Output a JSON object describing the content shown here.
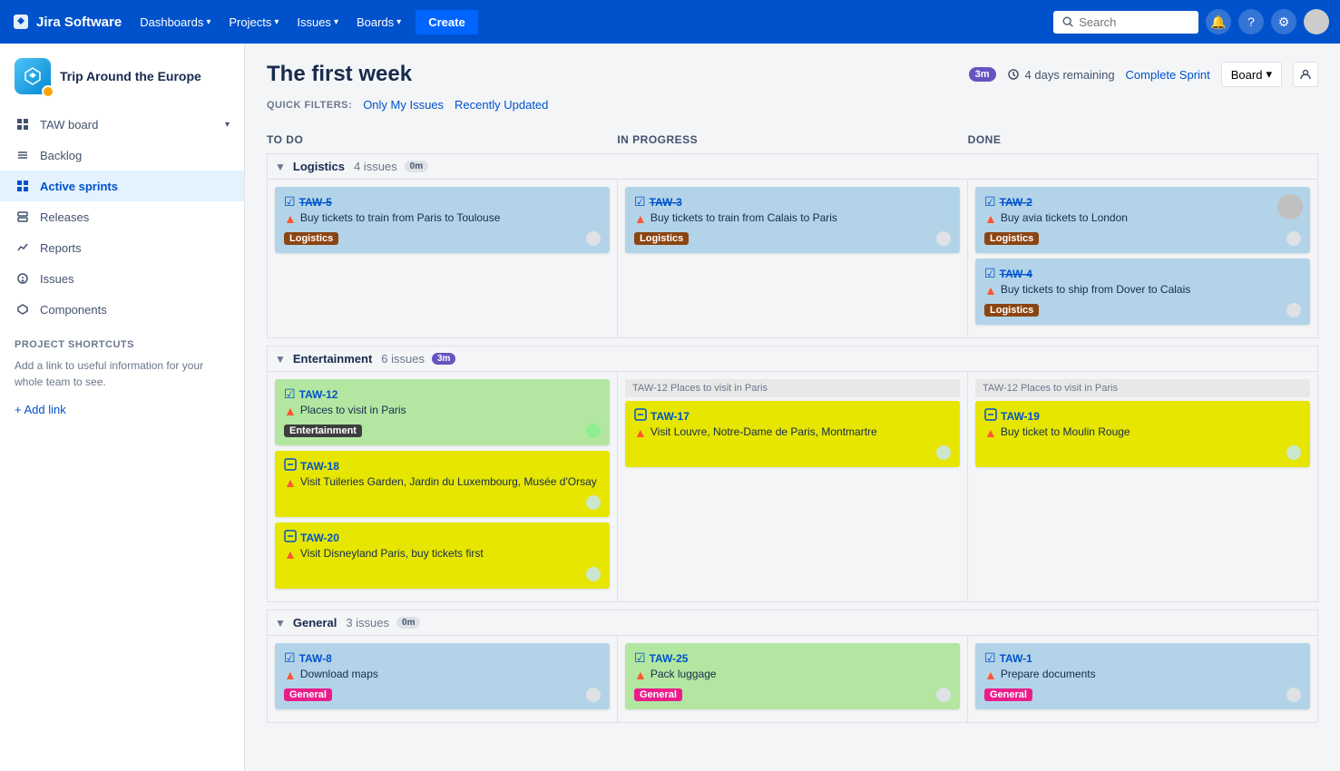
{
  "topnav": {
    "logo_text": "Jira Software",
    "nav_items": [
      {
        "label": "Dashboards",
        "caret": true
      },
      {
        "label": "Projects",
        "caret": true
      },
      {
        "label": "Issues",
        "caret": true
      },
      {
        "label": "Boards",
        "caret": true
      }
    ],
    "create_label": "Create",
    "search_placeholder": "Search"
  },
  "sidebar": {
    "project_name": "Trip Around the Europe",
    "nav_items": [
      {
        "label": "TAW board",
        "icon": "grid",
        "has_caret": true
      },
      {
        "label": "Backlog",
        "icon": "list"
      },
      {
        "label": "Active sprints",
        "icon": "grid",
        "active": true
      },
      {
        "label": "Releases",
        "icon": "layers"
      },
      {
        "label": "Reports",
        "icon": "chart"
      },
      {
        "label": "Issues",
        "icon": "issue"
      },
      {
        "label": "Components",
        "icon": "components"
      }
    ],
    "shortcuts_title": "PROJECT SHORTCUTS",
    "shortcuts_text": "Add a link to useful information for your whole team to see.",
    "add_link_label": "+ Add link"
  },
  "board": {
    "title": "The first week",
    "sprint_badge": "3m",
    "days_remaining": "4 days remaining",
    "complete_sprint_label": "Complete Sprint",
    "board_dropdown_label": "Board",
    "quick_filters_label": "QUICK FILTERS:",
    "filters": [
      "Only My Issues",
      "Recently Updated"
    ],
    "columns": [
      "To Do",
      "In Progress",
      "Done"
    ],
    "swimlanes": [
      {
        "name": "Logistics",
        "count": "4 issues",
        "time_badge": "0m",
        "time_badge_zero": true,
        "columns": [
          {
            "cards": [
              {
                "id": "TAW-5",
                "title": "Buy tickets to train from Paris to Toulouse",
                "label": "Logistics",
                "label_class": "label-logistics",
                "color": "card-blue",
                "icon": "checkbox",
                "strikethrough": true,
                "priority": "up"
              }
            ]
          },
          {
            "cards": [
              {
                "id": "TAW-3",
                "title": "Buy tickets to train from Calais to Paris",
                "label": "Logistics",
                "label_class": "label-logistics",
                "color": "card-blue",
                "icon": "checkbox",
                "strikethrough": true,
                "priority": "up"
              }
            ]
          },
          {
            "cards": [
              {
                "id": "TAW-2",
                "title": "Buy avia tickets to London",
                "label": "Logistics",
                "label_class": "label-logistics",
                "color": "card-blue",
                "icon": "checkbox",
                "strikethrough": true,
                "priority": "up",
                "has_avatar": true
              },
              {
                "id": "TAW-4",
                "title": "Buy tickets to ship from Dover to Calais",
                "label": "Logistics",
                "label_class": "label-logistics",
                "color": "card-blue",
                "icon": "checkbox",
                "strikethrough": true,
                "priority": "up"
              }
            ]
          }
        ]
      },
      {
        "name": "Entertainment",
        "count": "6 issues",
        "time_badge": "3m",
        "time_badge_zero": false,
        "columns": [
          {
            "cards": [
              {
                "id": "TAW-12",
                "title": "Places to visit in Paris",
                "label": "Entertainment",
                "label_class": "label-entertainment",
                "color": "card-green",
                "icon": "checkbox",
                "strikethrough": false,
                "priority": "up"
              },
              {
                "id": "TAW-18",
                "title": "Visit Tuileries Garden, Jardin du Luxembourg, Musée d'Orsay",
                "label": null,
                "color": "card-yellow",
                "icon": "task",
                "strikethrough": false,
                "priority": "up"
              },
              {
                "id": "TAW-20",
                "title": "Visit Disneyland Paris, buy tickets first",
                "label": null,
                "color": "card-yellow",
                "icon": "task",
                "strikethrough": false,
                "priority": "up"
              }
            ]
          },
          {
            "parent_header": "TAW-12  Places to visit in Paris",
            "cards": [
              {
                "id": "TAW-17",
                "title": "Visit Louvre, Notre-Dame de Paris, Montmartre",
                "label": null,
                "color": "card-yellow",
                "icon": "task",
                "strikethrough": false,
                "priority": "up"
              }
            ]
          },
          {
            "parent_header": "TAW-12  Places to visit in Paris",
            "cards": [
              {
                "id": "TAW-19",
                "title": "Buy ticket to Moulin Rouge",
                "label": null,
                "color": "card-yellow",
                "icon": "task",
                "strikethrough": false,
                "priority": "up"
              }
            ]
          }
        ]
      },
      {
        "name": "General",
        "count": "3 issues",
        "time_badge": "0m",
        "time_badge_zero": true,
        "columns": [
          {
            "cards": [
              {
                "id": "TAW-8",
                "title": "Download maps",
                "label": "General",
                "label_class": "label-general",
                "color": "card-blue",
                "icon": "checkbox",
                "strikethrough": false,
                "priority": "up"
              }
            ]
          },
          {
            "cards": [
              {
                "id": "TAW-25",
                "title": "Pack luggage",
                "label": "General",
                "label_class": "label-general",
                "color": "card-green",
                "icon": "checkbox",
                "strikethrough": false,
                "priority": "up"
              }
            ]
          },
          {
            "cards": [
              {
                "id": "TAW-1",
                "title": "Prepare documents",
                "label": "General",
                "label_class": "label-general",
                "color": "card-blue",
                "icon": "checkbox",
                "strikethrough": false,
                "priority": "up"
              }
            ]
          }
        ]
      }
    ]
  }
}
